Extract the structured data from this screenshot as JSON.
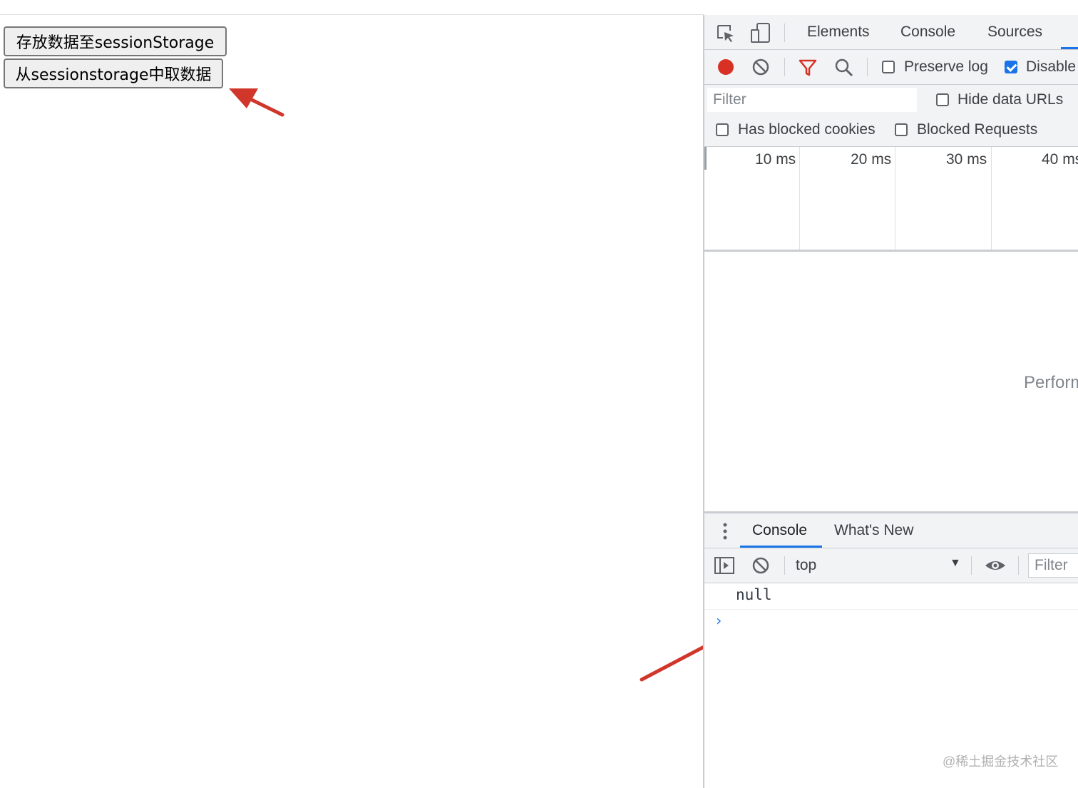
{
  "page": {
    "buttons": {
      "save": "存放数据至sessionStorage",
      "get": "从sessionstorage中取数据"
    }
  },
  "devtools": {
    "tabs": [
      "Elements",
      "Console",
      "Sources"
    ],
    "network_toolbar": {
      "preserve_log": {
        "label": "Preserve log",
        "checked": false
      },
      "disable_cache": {
        "label": "Disable",
        "checked": true
      }
    },
    "filter": {
      "placeholder": "Filter",
      "hide_data_urls": {
        "label": "Hide data URLs",
        "checked": false
      },
      "has_blocked_cookies": {
        "label": "Has blocked cookies",
        "checked": false
      },
      "blocked_requests": {
        "label": "Blocked Requests",
        "checked": false
      }
    },
    "timeline_ticks": [
      "10 ms",
      "20 ms",
      "30 ms",
      "40 ms"
    ],
    "empty_text": "Perform",
    "drawer": {
      "tabs": [
        "Console",
        "What's New"
      ],
      "active": "Console"
    },
    "console_toolbar": {
      "context": "top",
      "filter_placeholder": "Filter"
    },
    "console_output": [
      "null"
    ],
    "prompt": "›"
  },
  "watermark": "@稀土掘金技术社区",
  "colors": {
    "accent": "#1a73e8",
    "record": "#d93025",
    "annotation_arrow": "#d0362a"
  }
}
